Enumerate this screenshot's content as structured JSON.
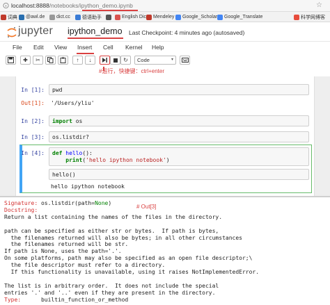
{
  "browser": {
    "url_host": "localhost:8888",
    "url_path": "/notebooks/ipython_demo.ipynb",
    "bookmarks": [
      {
        "label": "词典",
        "color": "#c0392b"
      },
      {
        "label": "@awl.de",
        "color": "#2a6fb0"
      },
      {
        "label": "dict.cc",
        "color": "#999999"
      },
      {
        "label": "德语助手",
        "color": "#3a7bd5"
      },
      {
        "label": "",
        "color": "#555555"
      },
      {
        "label": "English Dic",
        "color": "#d9534f"
      },
      {
        "label": "Mendeley",
        "color": "#c0392b"
      },
      {
        "label": "Google_Scholar",
        "color": "#4285f4"
      },
      {
        "label": "Google_Translate",
        "color": "#4285f4"
      },
      {
        "label": "科学网博客",
        "color": "#e74c3c"
      }
    ]
  },
  "header": {
    "logo_text": "jupyter",
    "notebook_name": "ipython_demo",
    "checkpoint": "Last Checkpoint: 4 minutes ago (autosaved)"
  },
  "menu": [
    "File",
    "Edit",
    "View",
    "Insert",
    "Cell",
    "Kernel",
    "Help"
  ],
  "toolbar": {
    "cell_type": "Code",
    "annotation": "#运行，快捷键：ctrl+enter"
  },
  "cells": [
    {
      "in_prompt": "In [1]:",
      "code": "pwd",
      "out_prompt": "Out[1]:",
      "output": "'/Users/yliu'"
    },
    {
      "in_prompt": "In [2]:",
      "code_kw": "import",
      "code_rest": " os"
    },
    {
      "in_prompt": "In [3]:",
      "code": "os.listdir?"
    },
    {
      "in_prompt": "In [4]:",
      "def_kw": "def",
      "fn_name": "hello",
      "def_rest": "():",
      "print_indent": "    ",
      "print_fn": "print",
      "print_open": "(",
      "print_str": "'hello ipython notebook'",
      "print_close": ")",
      "call": "hello()",
      "output": "hello ipython notebook"
    }
  ],
  "pager": {
    "note": "# Out[3]",
    "signature_label": "Signature:",
    "signature_pre": " os.listdir(path=",
    "signature_none": "None",
    "signature_post": ")",
    "docstring_label": "Docstring:",
    "body": "Return a list containing the names of the files in the directory.\n\npath can be specified as either str or bytes.  If path is bytes,\n  the filenames returned will also be bytes; in all other circumstances\n  the filenames returned will be str.\nIf path is None, uses the path='.'.\nOn some platforms, path may also be specified as an open file descriptor;\\\n  the file descriptor must refer to a directory.\n  If this functionality is unavailable, using it raises NotImplementedError.\n\nThe list is in arbitrary order.  It does not include the special\nentries '.' and '..' even if they are present in the directory.",
    "type_label": "Type:",
    "type_value": "      builtin_function_or_method"
  }
}
